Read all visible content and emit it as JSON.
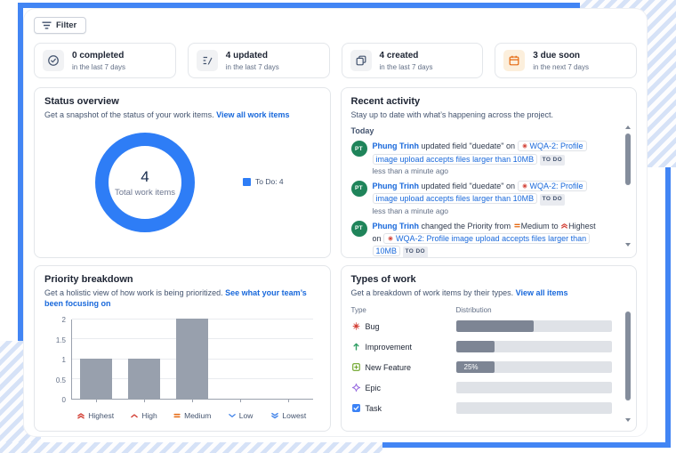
{
  "colors": {
    "frame_blue": "#4285f4",
    "link_blue": "#1868db",
    "donut_blue": "#2e7df6",
    "bar_gray": "#98a0ad",
    "distribution_gray": "#7d8594",
    "avatar_green": "#1f845a",
    "bug_red": "#d4453b",
    "medium_orange": "#e56910"
  },
  "toolbar": {
    "filter_label": "Filter"
  },
  "stats": [
    {
      "icon": "check-circle-icon",
      "title": "0 completed",
      "subtitle": "in the last 7 days"
    },
    {
      "icon": "edit-icon",
      "title": "4 updated",
      "subtitle": "in the last 7 days"
    },
    {
      "icon": "created-pages-icon",
      "title": "4 created",
      "subtitle": "in the last 7 days"
    },
    {
      "icon": "calendar-icon",
      "title": "3 due soon",
      "subtitle": "in the next 7 days"
    }
  ],
  "status_overview": {
    "title": "Status overview",
    "subtitle": "Get a snapshot of the status of your work items.",
    "link_label": "View all work items",
    "chart_data": {
      "type": "pie",
      "center_value": "4",
      "center_label": "Total work items",
      "segments": [
        {
          "label": "To Do",
          "value": 4,
          "color": "#2e7df6"
        }
      ],
      "legend": [
        {
          "label": "To Do: 4",
          "color": "#2e7df6"
        }
      ],
      "legend_position": "right"
    }
  },
  "recent_activity": {
    "title": "Recent activity",
    "subtitle": "Stay up to date with what’s happening across the project.",
    "group_label": "Today",
    "items": [
      {
        "avatar_initials": "PT",
        "actor": "Phung Trinh",
        "action": "updated field \"duedate\" on",
        "issue_title": "WQA-2: Profile image upload accepts files larger than 10MB",
        "status_badge": "TO DO",
        "timestamp": "less than a minute ago"
      },
      {
        "avatar_initials": "PT",
        "actor": "Phung Trinh",
        "action": "updated field \"duedate\" on",
        "issue_title": "WQA-2: Profile image upload accepts files larger than 10MB",
        "status_badge": "TO DO",
        "timestamp": "less than a minute ago"
      },
      {
        "avatar_initials": "PT",
        "actor": "Phung Trinh",
        "action": "changed the Priority from",
        "from_priority": "Medium",
        "connector": "to",
        "to_priority": "Highest",
        "suffix": "on",
        "issue_title": "WQA-2: Profile image upload accepts files larger than 10MB",
        "status_badge": "TO DO"
      }
    ]
  },
  "priority_breakdown": {
    "title": "Priority breakdown",
    "subtitle": "Get a holistic view of how work is being prioritized.",
    "link_label": "See what your team’s been focusing on",
    "chart_data": {
      "type": "bar",
      "categories": [
        "Highest",
        "High",
        "Medium",
        "Low",
        "Lowest"
      ],
      "category_icons": [
        "priority-highest-icon",
        "priority-high-icon",
        "priority-medium-icon",
        "priority-low-icon",
        "priority-lowest-icon"
      ],
      "values": [
        1,
        1,
        2,
        0,
        0
      ],
      "ylim": [
        0,
        2
      ],
      "ytick_labels": [
        "2",
        "1.5",
        "1",
        "0.5",
        "0"
      ],
      "grid": true,
      "bar_color": "#98a0ad"
    }
  },
  "types_of_work": {
    "title": "Types of work",
    "subtitle": "Get a breakdown of work items by their types.",
    "link_label": "View all items",
    "columns": {
      "type": "Type",
      "distribution": "Distribution"
    },
    "chart_data": {
      "type": "bar",
      "orientation": "horizontal",
      "categories": [
        "Bug",
        "Improvement",
        "New Feature",
        "Epic",
        "Task"
      ],
      "values_percent": [
        50,
        25,
        25,
        0,
        0
      ],
      "bar_labels": [
        "",
        "",
        "25%",
        "",
        ""
      ]
    },
    "rows": [
      {
        "label": "Bug",
        "icon": "bug-icon",
        "percent": 50,
        "bar_label": ""
      },
      {
        "label": "Improvement",
        "icon": "improvement-icon",
        "percent": 25,
        "bar_label": ""
      },
      {
        "label": "New Feature",
        "icon": "new-feature-icon",
        "percent": 25,
        "bar_label": "25%"
      },
      {
        "label": "Epic",
        "icon": "epic-icon",
        "percent": 0,
        "bar_label": ""
      },
      {
        "label": "Task",
        "icon": "task-icon",
        "percent": 0,
        "bar_label": ""
      }
    ]
  }
}
